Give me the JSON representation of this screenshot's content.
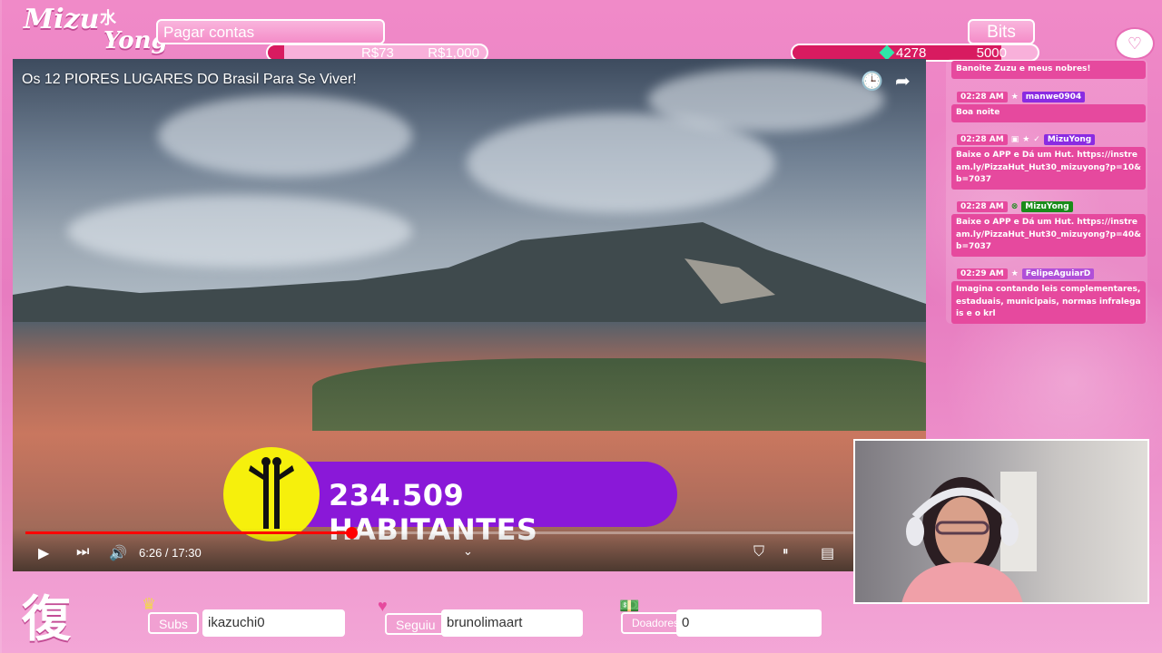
{
  "branding": {
    "logo_part1": "Mizu",
    "logo_kanji": "水",
    "logo_part2": "Yong",
    "bottom_kanji": "復"
  },
  "goal": {
    "label": "Pagar contas",
    "current": "R$73",
    "target": "R$1,000"
  },
  "bits": {
    "label": "Bits",
    "current": "4278",
    "target": "5000",
    "gem_color": "#2ee6a8"
  },
  "video": {
    "title": "Os 12 PIORES LUGARES DO Brasil Para Se Viver!",
    "banner_text": "234.509 HABITANTES",
    "time_display": "6:26 / 17:30",
    "progress_fraction": 0.367,
    "icons": [
      "watch-later-icon",
      "share-icon",
      "play-icon",
      "next-icon",
      "volume-icon",
      "chevron-down-icon",
      "autoplay-icon",
      "pause-toggle-icon",
      "subtitles-icon"
    ]
  },
  "chat": {
    "messages": [
      {
        "time": "",
        "name": "",
        "text": "Banoite Zuzu e meus nobres!"
      },
      {
        "time": "02:28 AM",
        "name": "manwe0904",
        "name_color": "#8a2be2",
        "text": "Boa noite"
      },
      {
        "time": "02:28 AM",
        "name": "MizuYong",
        "name_color": "#8a2be2",
        "text": "Baixe o APP e Dá um Hut. https://instream.ly/PizzaHut_Hut30_mizuyong?p=10&b=7037"
      },
      {
        "time": "02:28 AM",
        "name": "MizuYong",
        "name_color": "#1a8c1a",
        "text": "Baixe o APP e Dá um Hut. https://instream.ly/PizzaHut_Hut30_mizuyong?p=40&b=7037"
      },
      {
        "time": "02:29 AM",
        "name": "FelipeAguiarD",
        "name_color": "#b04fd8",
        "text": "Imagina contando leis complementares, estaduais, municipais, normas infralegais e o krl"
      }
    ]
  },
  "footer": {
    "subs_label": "Subs",
    "subs_value": "ikazuchi0",
    "follow_label": "Seguiu",
    "follow_value": "brunolimaart",
    "donors_label": "Doadores",
    "donors_value": "0"
  },
  "colors": {
    "accent_pink": "#e6499e",
    "progress_red": "#ff0000",
    "banner_purple": "#8a18d8",
    "banner_yellow": "#f6f00c"
  }
}
